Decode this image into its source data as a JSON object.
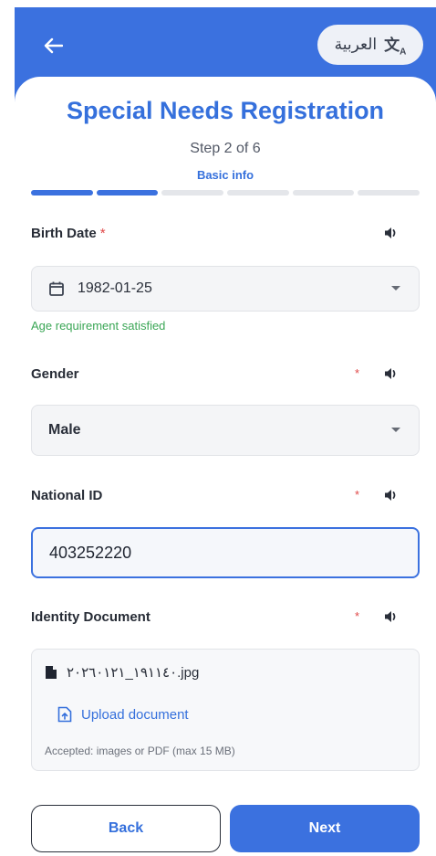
{
  "header": {
    "language_button": "العربية"
  },
  "page": {
    "title": "Special Needs Registration",
    "step": "Step 2 of 6",
    "step_name": "Basic info",
    "progress": {
      "completed": 2,
      "total": 6
    }
  },
  "fields": {
    "birth_date": {
      "label": "Birth Date",
      "required_mark": "*",
      "value": "1982-01-25",
      "helper": "Age requirement satisfied"
    },
    "gender": {
      "label": "Gender",
      "required_mark": "*",
      "value": "Male"
    },
    "national_id": {
      "label": "National ID",
      "required_mark": "*",
      "value": "403252220"
    },
    "identity_document": {
      "label": "Identity Document",
      "required_mark": "*",
      "file_name": "١٩١١٤٠_٢٠٢٦٠١٢١.jpg",
      "upload_label": "Upload document",
      "accepted_note": "Accepted: images or PDF (max 15 MB)"
    }
  },
  "actions": {
    "back": "Back",
    "next": "Next"
  },
  "colors": {
    "primary": "#3b71df",
    "required": "#e04848",
    "success": "#3aa655"
  },
  "icons": [
    "back-arrow-icon",
    "translate-icon",
    "speaker-icon",
    "calendar-icon",
    "file-icon",
    "upload-icon",
    "chevron-down-icon"
  ]
}
